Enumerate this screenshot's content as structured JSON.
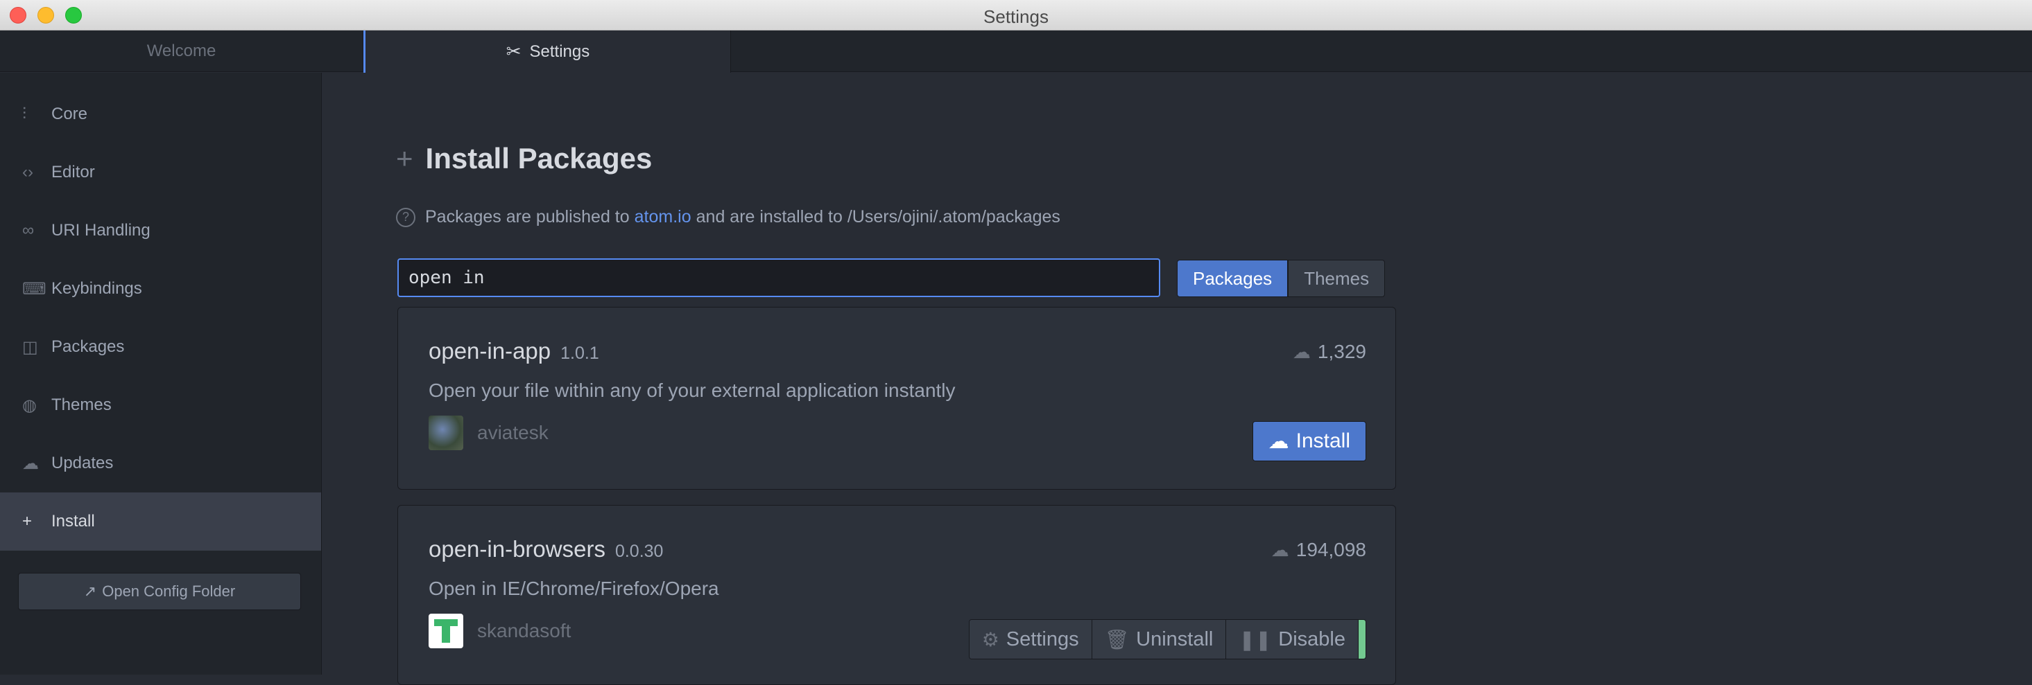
{
  "window": {
    "title": "Settings"
  },
  "tabs": [
    {
      "label": "Welcome"
    },
    {
      "label": "Settings"
    }
  ],
  "sidebar": {
    "items": [
      {
        "label": "Core",
        "icon": "sliders-icon"
      },
      {
        "label": "Editor",
        "icon": "code-icon"
      },
      {
        "label": "URI Handling",
        "icon": "link-icon"
      },
      {
        "label": "Keybindings",
        "icon": "keyboard-icon"
      },
      {
        "label": "Packages",
        "icon": "package-icon"
      },
      {
        "label": "Themes",
        "icon": "paintcan-icon"
      },
      {
        "label": "Updates",
        "icon": "cloud-download-icon"
      },
      {
        "label": "Install",
        "icon": "plus-icon",
        "active": true
      }
    ],
    "open_config_label": "Open Config Folder"
  },
  "install": {
    "heading": "Install Packages",
    "info_prefix": "Packages are published to",
    "info_link": "atom.io",
    "info_suffix": "and are installed to /Users/ojini/.atom/packages",
    "search_value": "open in",
    "toggle_packages": "Packages",
    "toggle_themes": "Themes"
  },
  "packages": [
    {
      "name": "open-in-app",
      "version": "1.0.1",
      "downloads": "1,329",
      "description": "Open your file within any of your external application instantly",
      "author": "aviatesk",
      "install_label": "Install"
    },
    {
      "name": "open-in-browsers",
      "version": "0.0.30",
      "downloads": "194,098",
      "description": "Open in IE/Chrome/Firefox/Opera",
      "author": "skandasoft",
      "settings_label": "Settings",
      "uninstall_label": "Uninstall",
      "disable_label": "Disable"
    }
  ],
  "colors": {
    "accent": "#568af2",
    "button_primary": "#4d78cc",
    "link": "#6494ed",
    "enabled": "#73c990"
  }
}
